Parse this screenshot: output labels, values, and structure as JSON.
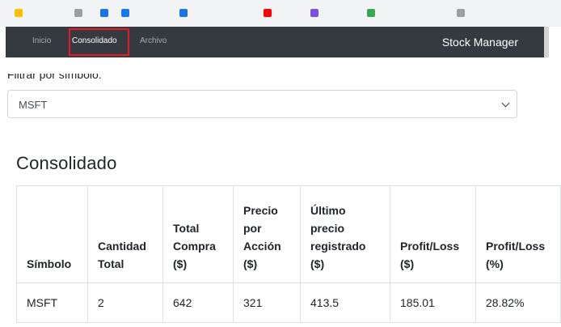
{
  "navbar": {
    "links": [
      {
        "label": "Inicio"
      },
      {
        "label": "Consolidado"
      },
      {
        "label": "Archivo"
      }
    ],
    "brand": "Stock Manager",
    "background": "#343a40"
  },
  "filter": {
    "label": "Filtrar por símbolo:",
    "selected": "MSFT"
  },
  "page_title": "Consolidado",
  "table": {
    "headers": [
      [
        "Símbolo"
      ],
      [
        "Cantidad",
        "Total"
      ],
      [
        "Total",
        "Compra",
        "($)"
      ],
      [
        "Precio",
        "por",
        "Acción",
        "($)"
      ],
      [
        "Último",
        "precio",
        "registrado",
        "($)"
      ],
      [
        "Profit/Loss",
        "($)"
      ],
      [
        "Profit/Loss",
        "(%)"
      ]
    ],
    "rows": [
      [
        "MSFT",
        "2",
        "642",
        "321",
        "413.5",
        "185.01",
        "28.82%"
      ]
    ]
  },
  "colors": {
    "highlight": "#e31b23",
    "border": "#dee2e6"
  }
}
